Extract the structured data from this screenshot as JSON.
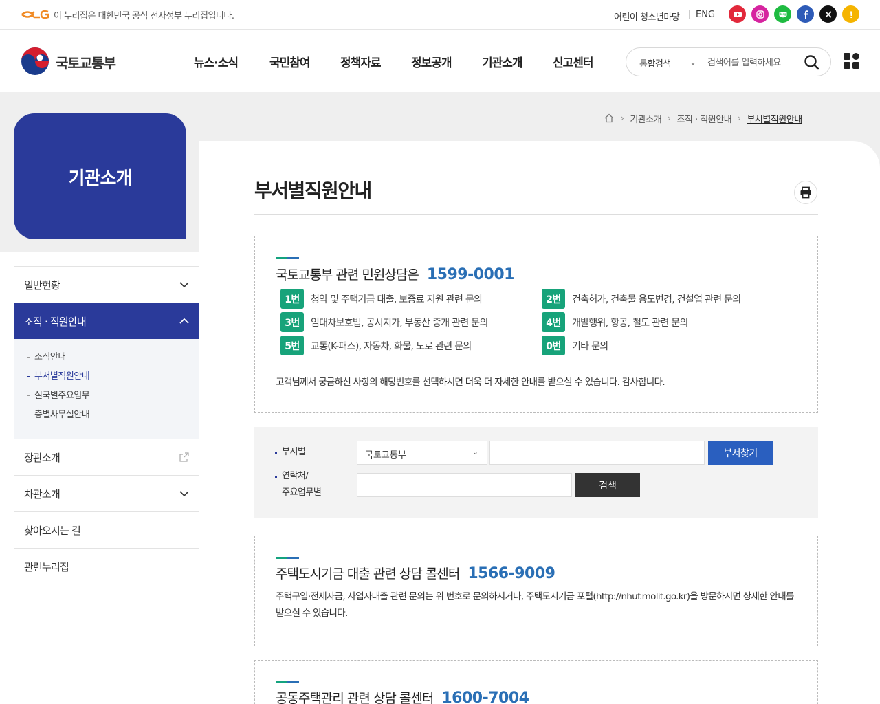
{
  "topbar": {
    "gov_notice": "이 누리집은 대한민국 공식 전자정부 누리집입니다.",
    "kids_link": "어린이 청소년마당",
    "eng_link": "ENG",
    "sns": [
      {
        "name": "youtube-icon",
        "color": "#e2283b"
      },
      {
        "name": "instagram-icon",
        "color": "#d6249f"
      },
      {
        "name": "blog-icon",
        "color": "#1fbb41"
      },
      {
        "name": "facebook-icon",
        "color": "#2e5bb7"
      },
      {
        "name": "x-icon",
        "color": "#111111"
      },
      {
        "name": "kakao-story-icon",
        "color": "#f5b400"
      }
    ]
  },
  "header": {
    "logo_text": "국토교통부",
    "gnb": [
      "뉴스·소식",
      "국민참여",
      "정책자료",
      "정보공개",
      "기관소개",
      "신고센터"
    ],
    "search": {
      "category": "통합검색",
      "placeholder": "검색어를 입력하세요"
    }
  },
  "breadcrumb": [
    "기관소개",
    "조직 · 직원안내",
    "부서별직원안내"
  ],
  "sidebar": {
    "title": "기관소개",
    "items": [
      {
        "label": "일반현황"
      },
      {
        "label": "조직 · 직원안내"
      },
      {
        "label": "장관소개"
      },
      {
        "label": "차관소개"
      },
      {
        "label": "찾아오시는 길"
      },
      {
        "label": "관련누리집"
      }
    ],
    "subitems": [
      "조직안내",
      "부서별직원안내",
      "실국별주요업무",
      "층별사무실안내"
    ]
  },
  "main": {
    "title": "부서별직원안내",
    "civil": {
      "heading": "국토교통부 관련 민원상담은",
      "phone": "1599-0001",
      "options": [
        {
          "num": "1번",
          "text": "청약 및 주택기금 대출, 보증료 지원 관련 문의"
        },
        {
          "num": "2번",
          "text": "건축허가, 건축물 용도변경, 건설업 관련 문의"
        },
        {
          "num": "3번",
          "text": "임대차보호법, 공시지가, 부동산 중개 관련 문의"
        },
        {
          "num": "4번",
          "text": "개발행위, 항공, 철도 관련 문의"
        },
        {
          "num": "5번",
          "text": "교통(K-패스), 자동차, 화물, 도로 관련 문의"
        },
        {
          "num": "0번",
          "text": "기타 문의"
        }
      ],
      "note": "고객님께서 궁금하신 사항의 해당번호를 선택하시면 더욱 더 자세한 안내를 받으실 수 있습니다. 감사합니다."
    },
    "form": {
      "dept_label": "부서별",
      "dept_selected": "국토교통부",
      "find_button": "부서찾기",
      "contact_label_1": "연락처/",
      "contact_label_2": "주요업무별",
      "search_button": "검색"
    },
    "housing": {
      "heading": "주택도시기금 대출 관련 상담 콜센터",
      "phone": "1566-9009",
      "desc": "주택구입·전세자금, 사업자대출 관련 문의는 위 번호로 문의하시거나, 주택도시기금 포털(http://nhuf.molit.go.kr)을 방문하시면 상세한 안내를 받으실 수 있습니다."
    },
    "apartment": {
      "heading": "공동주택관리 관련 상담 콜센터",
      "phone": "1600-7004"
    }
  }
}
